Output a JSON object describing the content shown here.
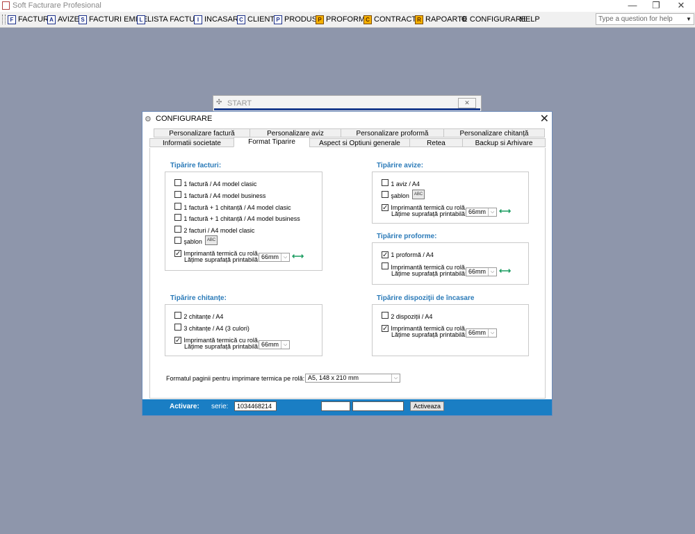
{
  "app": {
    "title": "Soft Facturare Profesional"
  },
  "menu": {
    "items": [
      "FACTURI",
      "AVIZE",
      "FACTURI EMISE",
      "LISTA FACTURI",
      "INCASARI",
      "CLIENTI",
      "PRODUSE",
      "PROFORME",
      "CONTRACTE",
      "RAPOARTE",
      "CONFIGURARE",
      "HELP"
    ],
    "icon_letters": [
      "F",
      "A",
      "S",
      "L",
      "I",
      "C",
      "P",
      "P",
      "C",
      "R"
    ],
    "help_placeholder": "Type a question for help"
  },
  "start_window": {
    "title": "START"
  },
  "dialog": {
    "title": "CONFIGURARE",
    "tabs_row1": [
      "Personalizare factură",
      "Personalizare aviz",
      "Personalizare proformă",
      "Personalizare chitanță"
    ],
    "tabs_row2": [
      "Informatii societate",
      "Format Tiparire",
      "Aspect si Optiuni generale",
      "Retea",
      "Backup si Arhivare"
    ],
    "active_tab": "Format Tiparire",
    "facturi": {
      "heading": "Tipărire facturi:",
      "options": [
        "1 factură / A4 model clasic",
        "1 factură / A4 model business",
        "1 factură + 1 chitanță / A4 model clasic",
        "1 factură + 1 chitanță / A4 model business",
        "2 facturi / A4 model clasic",
        "şablon"
      ],
      "thermal": "Imprimantă termică cu rolă.",
      "width_label": "Lățime suprafață printabilă:",
      "width_value": "66mm"
    },
    "avize": {
      "heading": "Tipărire avize:",
      "options": [
        "1 aviz / A4",
        "şablon"
      ],
      "thermal": "Imprimantă termică cu rolă.",
      "width_label": "Lățime suprafață printabilă:",
      "width_value": "66mm"
    },
    "proforme": {
      "heading": "Tipărire proforme:",
      "options": [
        "1 proformă / A4"
      ],
      "thermal": "Imprimantă termică cu rolă.",
      "width_label": "Lățime suprafață printabilă:",
      "width_value": "66mm"
    },
    "chitante": {
      "heading": "Tipărire chitanțe:",
      "options": [
        "2 chitanțe / A4",
        "3 chitanțe / A4 (3 culori)"
      ],
      "thermal": "Imprimantă termică cu rolă.",
      "width_label": "Lățime suprafață printabilă:",
      "width_value": "66mm"
    },
    "dispozitii": {
      "heading": "Tipărire dispoziţii de încasare",
      "options": [
        "2 dispoziții / A4"
      ],
      "thermal": "Imprimantă termică cu rolă.",
      "width_label": "Lățime suprafață printabilă:",
      "width_value": "66mm"
    },
    "format_roll": {
      "label": "Formatul paginii pentru imprimare termica pe rolă:",
      "value": "A5, 148 x 210 mm"
    },
    "activation": {
      "label": "Activare:",
      "serie_label": "serie:",
      "serie_value": "1034468214",
      "button": "Activeaza"
    },
    "template_button": "ABC",
    "arrow_symbol": "⟷"
  },
  "colors": {
    "desktop": "#8e96ab",
    "accent": "#2a7ab8",
    "activate_bar": "#1a7ec4"
  }
}
